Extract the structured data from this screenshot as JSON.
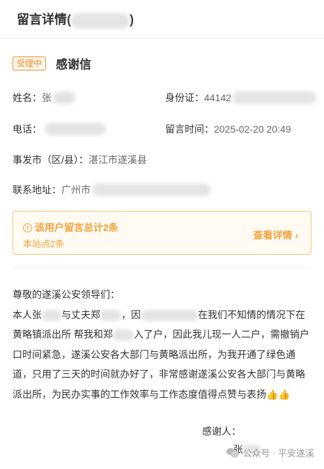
{
  "header": {
    "title_prefix": "留言详情(",
    "title_suffix": ")"
  },
  "message": {
    "status": "受理中",
    "title": "感谢信",
    "name_label": "姓名：",
    "name_value": "张",
    "id_label": "身份证：",
    "id_value": "44142",
    "phone_label": "电话：",
    "time_label": "留言时间：",
    "time_value": "2025-02-20 20:49",
    "city_label": "事发市（区/县）：",
    "city_value": "湛江市遂溪县",
    "address_label": "联系地址：",
    "address_value": "广州市"
  },
  "summary": {
    "main": "该用户留言总计2条",
    "sub": "本站点2条",
    "link": "查看详情"
  },
  "letter": {
    "greeting": "尊敬的遂溪公安领导们：",
    "p1_a": " 本人张",
    "p1_b": "与丈夫郑",
    "p1_c": "，因",
    "p1_d": "在我们不知情的情况下在",
    "line2_a": "黄略镇派出所 帮我和郑",
    "line2_b": "入了户，因此我儿现一人二户，需撤销户",
    "line3": "口时间紧急，遂溪公安各大部门与黄略派出所，为我开通了绿色通",
    "line4": "道，只用了三天的时间就办好了，非常感谢遂溪公安各大部门与黄略",
    "line5": "派出所，为民办实事的工作效率与工作态度值得点赞与表扬",
    "emoji": "👍👍",
    "thanks": "感谢人：",
    "signature": "张"
  },
  "watermark": {
    "text": "公众号 · 平安遂溪"
  }
}
